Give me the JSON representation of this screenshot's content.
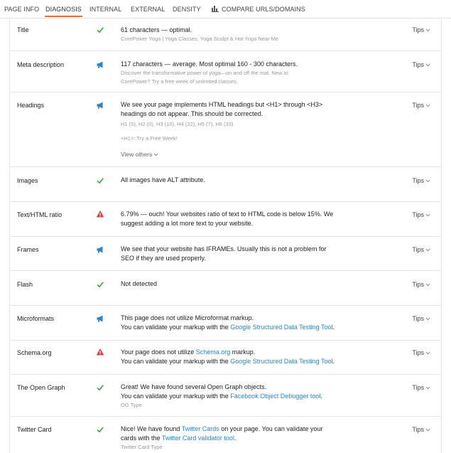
{
  "tabs": [
    {
      "label": "PAGE INFO"
    },
    {
      "label": "DIAGNOSIS"
    },
    {
      "label": "INTERNAL"
    },
    {
      "label": "EXTERNAL"
    },
    {
      "label": "DENSITY"
    },
    {
      "label": "COMPARE URLS/DOMAINS",
      "icon": "bar-chart-icon"
    }
  ],
  "active_tab": "DIAGNOSIS",
  "colors": {
    "accent": "#ff6a1a",
    "ok": "#3aa63a",
    "info": "#2a86c8",
    "warning": "#e03a3a",
    "link": "#2a86c8"
  },
  "tips_label": "Tips",
  "rows": [
    {
      "label": "Title",
      "status": "ok",
      "lines": [
        "61 characters — optimal."
      ],
      "sub": [
        "CorePower Yoga | Yoga Classes, Yoga Sculpt & Hot Yoga Near Me"
      ]
    },
    {
      "label": "Meta description",
      "status": "info",
      "lines": [
        "117 characters — average. Most optimal 160 - 300 characters."
      ],
      "sub": [
        "Discover the transformative power of yoga—on and off the mat. New to",
        "CorePower? Try a free week of unlimited classes."
      ]
    },
    {
      "label": "Headings",
      "status": "info",
      "lines": [
        "We see your page implements HTML headings but <H1> through <H3>",
        "headings do not appear. This should be corrected."
      ],
      "sub": [
        "H1 (5), H2 (0), H3 (10), H4 (22), H5 (7), H6 (33)",
        "<H1>: Try a Free Week!"
      ],
      "view_others": "View others"
    },
    {
      "label": "Images",
      "status": "ok",
      "lines": [
        "All images have ALT attribute."
      ]
    },
    {
      "label": "Text/HTML ratio",
      "status": "warning",
      "lines": [
        "6.79% — ouch! Your websites ratio of text to HTML code is below 15%. We",
        "suggest adding a lot more text to your website."
      ]
    },
    {
      "label": "Frames",
      "status": "info",
      "lines": [
        "We see that your website has IFRAMEs. Usually this is not a problem for",
        "SEO if they are used properly."
      ]
    },
    {
      "label": "Flash",
      "status": "ok",
      "lines": [
        "Not detected"
      ]
    },
    {
      "label": "Microformats",
      "status": "info",
      "line1": "This page does not utilize Microformat markup.",
      "line2_pre": "You can validate your markup with the ",
      "line2_link": "Google Structured Data Testing Tool",
      "line2_post": "."
    },
    {
      "label": "Schema.org",
      "status": "warning",
      "line1_pre": "Your page does not utilize ",
      "line1_link": "Schema.org",
      "line1_post": " markup.",
      "line2_pre": "You can validate your markup with the ",
      "line2_link": "Google Structured Data Testing Tool",
      "line2_post": "."
    },
    {
      "label": "The Open Graph",
      "status": "ok",
      "line1": "Great! We have found several Open Graph objects.",
      "line2_pre": "You can validate your markup with the ",
      "line2_link": "Facebook Object Debugger tool",
      "line2_post": ".",
      "sub": "OG Type"
    },
    {
      "label": "Twitter Card",
      "status": "ok",
      "line1_pre": "Nice! We have found ",
      "line1_link": "Twitter Cards",
      "line1_post": " on your page. You can validate your",
      "line2_pre": "cards with the ",
      "line2_link": "Twitter Card validator tool",
      "line2_post": ".",
      "sub": "Twitter Card Type"
    }
  ]
}
